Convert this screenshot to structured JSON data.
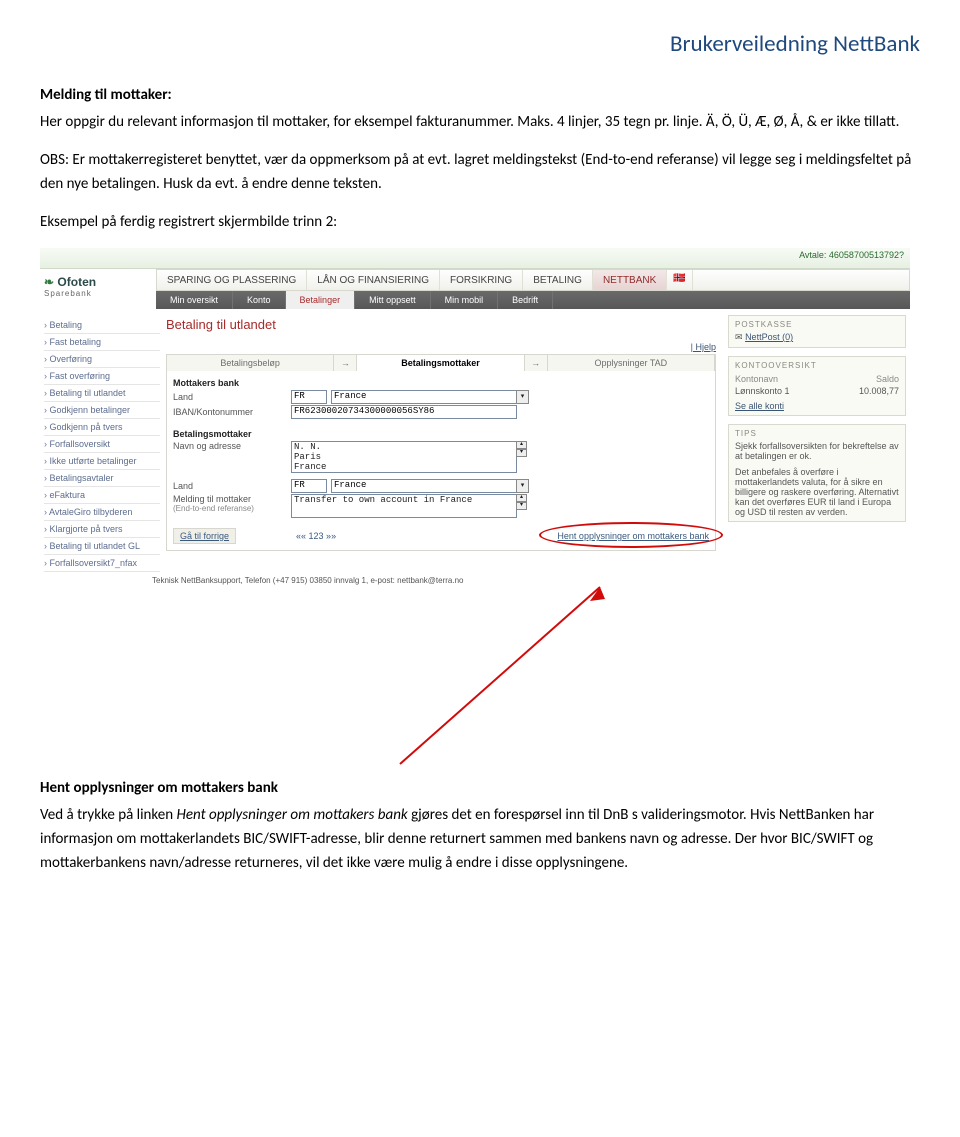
{
  "doc": {
    "header": "Brukerveiledning NettBank",
    "s1_heading": "Melding til mottaker:",
    "s1_p1": "Her oppgir du relevant informasjon til mottaker, for eksempel fakturanummer. Maks. 4 linjer, 35 tegn pr. linje. Ä, Ö, Ü, Æ, Ø, Å, & er ikke tillatt.",
    "s1_p2": "OBS: Er mottakerregisteret benyttet, vær da oppmerksom på at evt. lagret meldingstekst (End-to-end referanse) vil legge seg i meldingsfeltet på den nye betalingen. Husk da evt. å endre denne teksten.",
    "s1_p3": "Eksempel på ferdig registrert skjermbilde trinn 2:",
    "s2_heading": "Hent opplysninger om mottakers bank",
    "s2_p1a": "Ved å trykke på linken ",
    "s2_p1b": "Hent opplysninger om mottakers bank",
    "s2_p1c": " gjøres det en forespørsel inn til DnB s valideringsmotor. Hvis NettBanken har informasjon om mottakerlandets BIC/SWIFT-adresse, blir denne returnert sammen med bankens navn og adresse. Der hvor BIC/SWIFT og mottakerbankens navn/adresse returneres, vil det ikke være mulig å endre i disse opplysningene."
  },
  "shot": {
    "topbar": "Avtale: 46058700513792?",
    "logo": "Ofoten",
    "logo_sub": "Sparebank",
    "nav_main": [
      "SPARING OG PLASSERING",
      "LÅN OG FINANSIERING",
      "FORSIKRING",
      "BETALING",
      "NETTBANK"
    ],
    "nav_main_active": 4,
    "nav_sub": [
      "Min oversikt",
      "Konto",
      "Betalinger",
      "Mitt oppsett",
      "Min mobil",
      "Bedrift"
    ],
    "nav_sub_active": 2,
    "page_title": "Betaling til utlandet",
    "help": "| Hjelp",
    "sidebar": [
      "Betaling",
      "Fast betaling",
      "Overføring",
      "Fast overføring",
      "Betaling til utlandet",
      "Godkjenn betalinger",
      "Godkjenn på tvers",
      "Forfallsoversikt",
      "Ikke utførte betalinger",
      "Betalingsavtaler",
      "eFaktura",
      "AvtaleGiro tilbyderen",
      "Klargjorte på tvers",
      "Betaling til utlandet GL",
      "Forfallsoversikt7_nfax"
    ],
    "steps": [
      "Betalingsbeløp",
      "Betalingsmottaker",
      "Opplysninger TAD"
    ],
    "steps_active": 1,
    "form": {
      "h1": "Mottakers bank",
      "land_label": "Land",
      "land_code": "FR",
      "land_name": "France",
      "iban_label": "IBAN/Kontonummer",
      "iban": "FR62300020734300000056SY86",
      "h2": "Betalingsmottaker",
      "navn_label": "Navn og adresse",
      "navn_val": "N. N.\nParis\nFrance",
      "land2_label": "Land",
      "land2_code": "FR",
      "land2_name": "France",
      "melding_label": "Melding til mottaker",
      "melding_sub": "(End-to-end referanse)",
      "melding_val": "Transfer to own account in France",
      "btn_prev": "Gå til forrige",
      "btn_mid": "«« 123 »»",
      "btn_hent": "Hent opplysninger om mottakers bank"
    },
    "right": {
      "postkasse": "POSTKASSE",
      "nettpost": "NettPost (0)",
      "kontooversikt": "KONTOOVERSIKT",
      "kol1": "Kontonavn",
      "kol2": "Saldo",
      "acc_name": "Lønnskonto 1",
      "acc_bal": "10.008,77",
      "se_alle": "Se alle konti",
      "tips_h": "TIPS",
      "tips1": "Sjekk forfallsoversikten for bekreftelse av at betalingen er ok.",
      "tips2": "Det anbefales å overføre i mottakerlandets valuta, for å sikre en billigere og raskere overføring. Alternativt kan det overføres EUR til land i Europa og USD til resten av verden."
    },
    "footer": "Teknisk NettBanksupport, Telefon (+47 915) 03850 innvalg 1, e-post: nettbank@terra.no"
  }
}
